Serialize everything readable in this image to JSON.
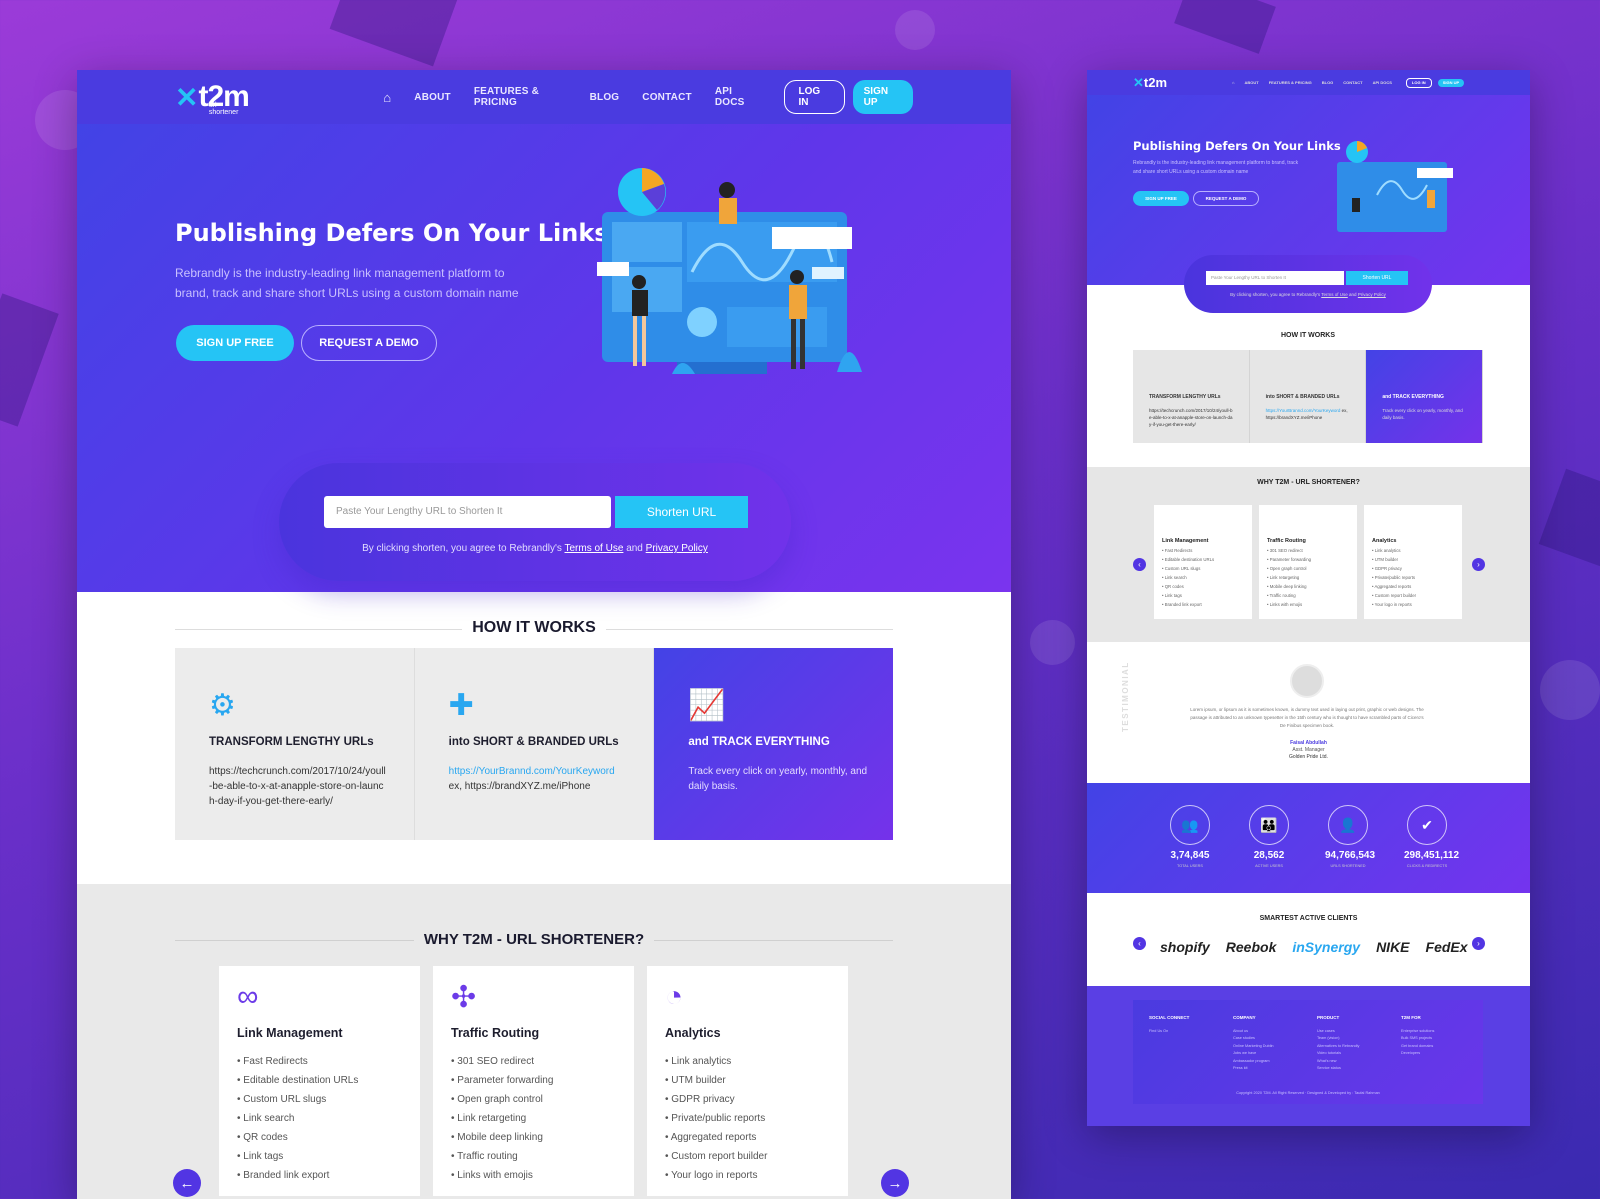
{
  "nav": {
    "brand": "t2m",
    "brand_sub": "url shortener",
    "links": [
      "ABOUT",
      "FEATURES & PRICING",
      "BLOG",
      "CONTACT",
      "API DOCS"
    ],
    "login": "LOG IN",
    "signup": "SIGN UP"
  },
  "hero": {
    "title": "Publishing Defers On Your Links",
    "desc": "Rebrandly is the industry-leading link management platform to brand, track and share short URLs using a custom domain name",
    "cta_primary": "SIGN UP FREE",
    "cta_secondary": "REQUEST A DEMO"
  },
  "shortener": {
    "placeholder": "Paste Your Lengthy URL to Shorten It",
    "button": "Shorten URL",
    "terms_prefix": "By clicking shorten, you agree to Rebrandly's",
    "terms_link": "Terms of Use",
    "and": "and",
    "privacy_link": "Privacy Policy"
  },
  "how_it_works": {
    "title": "HOW IT WORKS",
    "cards": [
      {
        "title": "TRANSFORM LENGTHY URLs",
        "text": "https://techcrunch.com/2017/10/24/youll-be-able-to-x-at-anapple-store-on-launch-day-if-you-get-there-early/"
      },
      {
        "title": "into SHORT & BRANDED URLs",
        "link": "https://YourBrannd.com/YourKeyword",
        "text": "ex, https://brandXYZ.me/iPhone"
      },
      {
        "title": "and TRACK EVERYTHING",
        "text": "Track every click on yearly, monthly, and daily basis."
      }
    ]
  },
  "why": {
    "title": "WHY T2M - URL SHORTENER?",
    "features": [
      {
        "title": "Link Management",
        "items": [
          "Fast Redirects",
          "Editable destination URLs",
          "Custom URL slugs",
          "Link search",
          "QR codes",
          "Link tags",
          "Branded link export"
        ]
      },
      {
        "title": "Traffic Routing",
        "items": [
          "301 SEO redirect",
          "Parameter forwarding",
          "Open graph control",
          "Link retargeting",
          "Mobile deep linking",
          "Traffic routing",
          "Links with emojis"
        ]
      },
      {
        "title": "Analytics",
        "items": [
          "Link analytics",
          "UTM builder",
          "GDPR privacy",
          "Private/public reports",
          "Aggregated reports",
          "Custom report builder",
          "Your logo in reports"
        ]
      }
    ]
  },
  "side": {
    "testimonial": {
      "label": "TESTIMONIAL",
      "quote": "Lorem ipsum, or lipsum as it is sometimes known, is dummy text used in laying out print, graphic or web designs. The passage is attributed to an unknown typesetter in the 15th century who is thought to have scrambled parts of Cicero's De Finibus specimen book.",
      "name": "Faisal Abdullah",
      "role": "Asst. Manager",
      "company": "Golden Pride Ltd."
    },
    "stats": [
      {
        "value": "3,74,845",
        "label": "TOTAL USERS"
      },
      {
        "value": "28,562",
        "label": "ACTIVE USERS"
      },
      {
        "value": "94,766,543",
        "label": "URLS SHORTENED"
      },
      {
        "value": "298,451,112",
        "label": "CLICKS & REDIRECTS"
      }
    ],
    "clients_title": "SMARTEST ACTIVE CLIENTS",
    "clients": [
      "shopify",
      "Reebok",
      "inSynergy",
      "NIKE",
      "FedEx"
    ],
    "footer": {
      "cols": [
        {
          "title": "SOCIAL CONNECT",
          "items": [
            "Find Us On"
          ]
        },
        {
          "title": "COMPANY",
          "items": [
            "About us",
            "Case studies",
            "Online Marketing Dublin",
            "Jobs we have",
            "Ambassador program",
            "Press kit"
          ]
        },
        {
          "title": "PRODUCT",
          "items": [
            "Use cases",
            "Team (vision)",
            "Alternatives to Rebrandly",
            "Video tutorials",
            "What's new",
            "Service status"
          ]
        },
        {
          "title": "T2M FOR",
          "items": [
            "Enterprise solutions",
            "Bulk SMS projects",
            "Get brand domains",
            "Developers"
          ]
        }
      ],
      "copyright": "Copyright 2020 T2M. All Right Reserved · Designed & Developed by : Taufal Rahman"
    }
  }
}
